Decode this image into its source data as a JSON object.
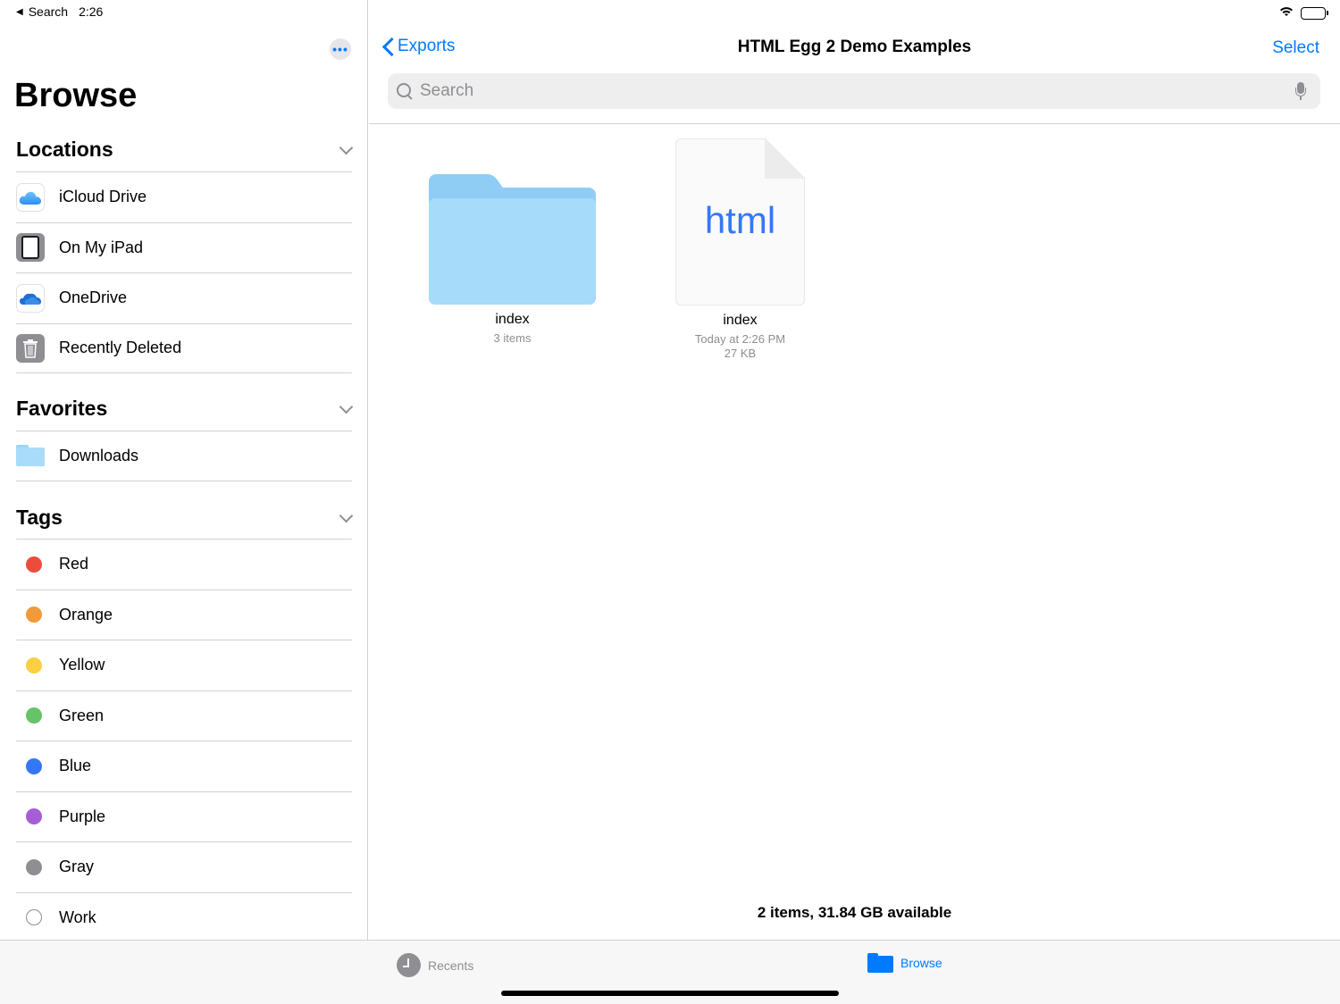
{
  "status_bar": {
    "back_label": "Search",
    "time": "2:26"
  },
  "sidebar": {
    "more_label": "•••",
    "title": "Browse",
    "sections": {
      "locations": {
        "title": "Locations",
        "items": [
          {
            "label": "iCloud Drive",
            "icon": "icloud-icon"
          },
          {
            "label": "On My iPad",
            "icon": "ipad-icon"
          },
          {
            "label": "OneDrive",
            "icon": "onedrive-icon"
          },
          {
            "label": "Recently Deleted",
            "icon": "trash-icon"
          }
        ]
      },
      "favorites": {
        "title": "Favorites",
        "items": [
          {
            "label": "Downloads",
            "icon": "downloads-folder-icon"
          }
        ]
      },
      "tags": {
        "title": "Tags",
        "items": [
          {
            "label": "Red",
            "color": "#eb4d3d"
          },
          {
            "label": "Orange",
            "color": "#f19a37"
          },
          {
            "label": "Yellow",
            "color": "#fad042"
          },
          {
            "label": "Green",
            "color": "#65c466"
          },
          {
            "label": "Blue",
            "color": "#3478f6"
          },
          {
            "label": "Purple",
            "color": "#a65ed6"
          },
          {
            "label": "Gray",
            "color": "#8e8e93"
          },
          {
            "label": "Work",
            "color": "#ffffff"
          }
        ]
      }
    }
  },
  "main": {
    "back_label": "Exports",
    "title": "HTML Egg 2 Demo Examples",
    "select_label": "Select",
    "search": {
      "placeholder": "Search"
    },
    "items": [
      {
        "name": "index",
        "kind": "folder",
        "meta1": "3 items"
      },
      {
        "name": "index",
        "kind": "html-file",
        "ext": "html",
        "meta1": "Today at 2:26 PM",
        "meta2": "27 KB"
      }
    ],
    "footer": "2 items, 31.84 GB available"
  },
  "tabbar": {
    "recents": "Recents",
    "browse": "Browse"
  },
  "colors": {
    "accent": "#007aff",
    "folder_light": "#a6dbfa",
    "folder_dark": "#8fcdf5"
  }
}
